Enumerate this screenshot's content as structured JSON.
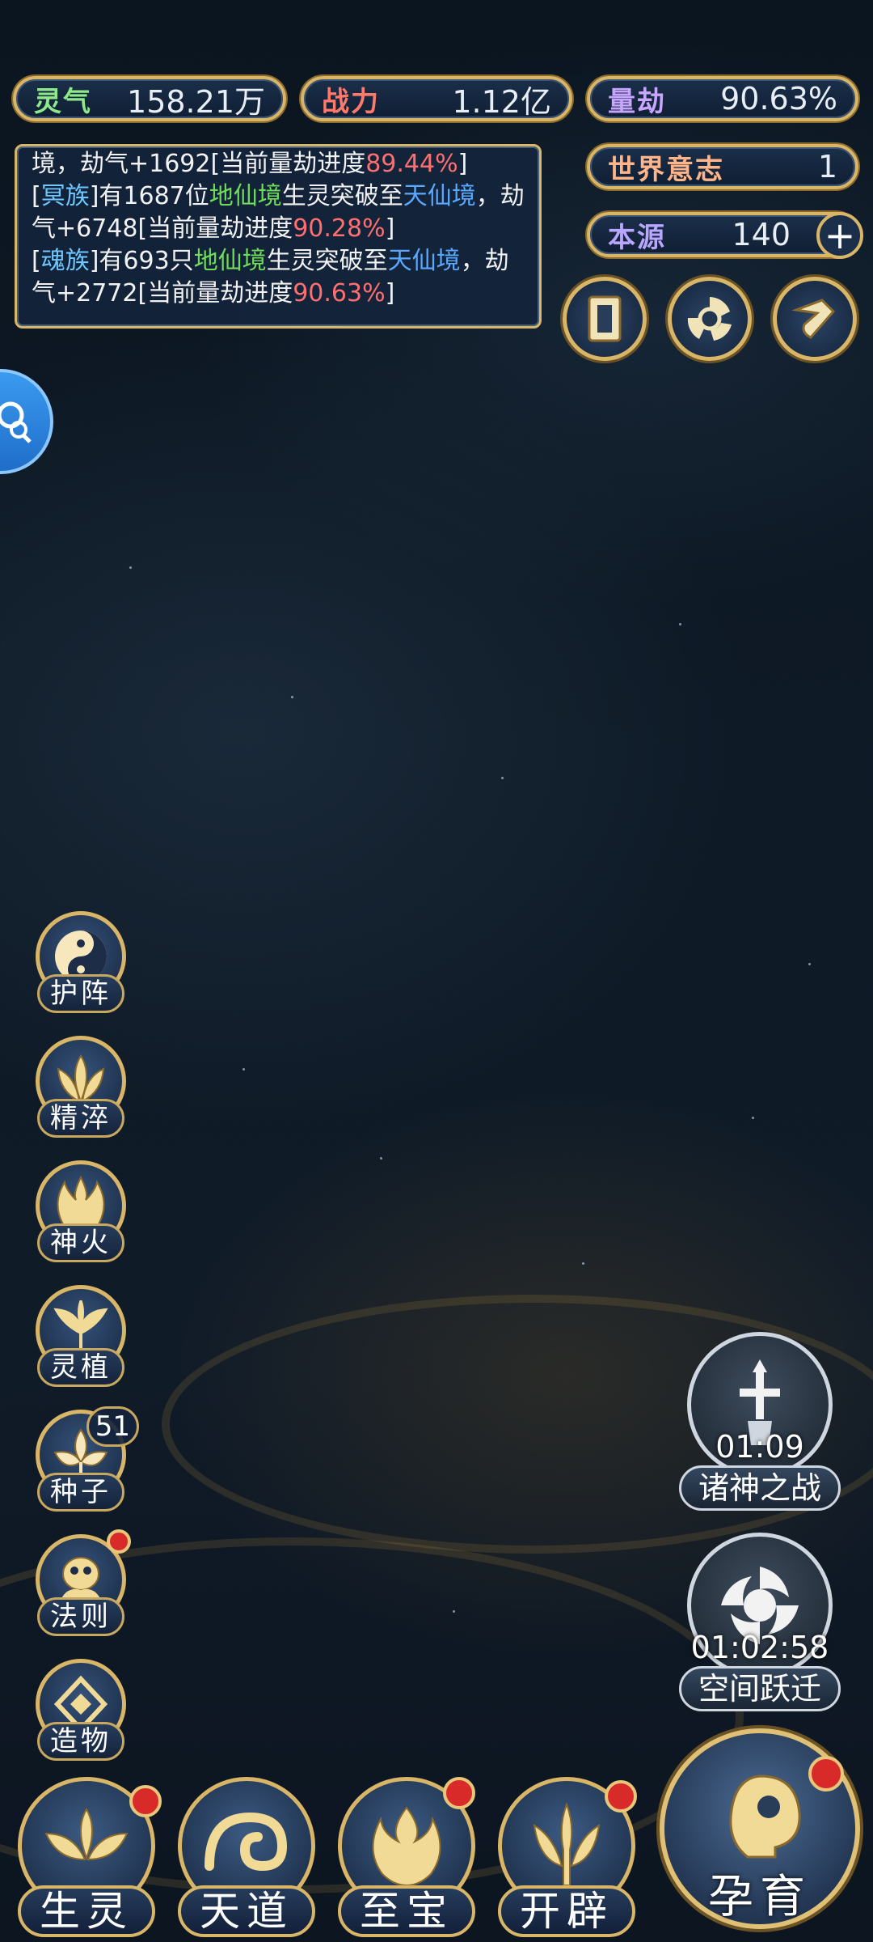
{
  "stats": {
    "lingqi": {
      "label": "灵气",
      "value": "158.21万"
    },
    "zhanli": {
      "label": "战力",
      "value": "1.12亿"
    },
    "liangjie": {
      "label": "量劫",
      "value": "90.63%"
    },
    "shijie": {
      "label": "世界意志",
      "value": "1"
    },
    "benyuan": {
      "label": "本源",
      "value": "140"
    }
  },
  "log": {
    "line0": {
      "prefix": "境，劫气+1692[当前量劫进度",
      "pct": "89.44%",
      "suffix": "]"
    },
    "line1": {
      "open": "[",
      "race": "冥族",
      "mid1": "]有1687位",
      "realm1": "地仙境",
      "mid2": "生灵突破至",
      "realm2": "天仙境",
      "mid3": "，劫气+6748[当前量劫进度",
      "pct": "90.28%",
      "suffix": "]"
    },
    "line2": {
      "open": "[",
      "race": "魂族",
      "mid1": "]有693只",
      "realm1": "地仙境",
      "mid2": "生灵突破至",
      "realm2": "天仙境",
      "mid3": "，劫气+2772[当前量劫进度",
      "pct": "90.63%",
      "suffix": "]"
    }
  },
  "top_icons": [
    "card-icon",
    "vortex-icon",
    "scroll-icon"
  ],
  "side_menu": [
    {
      "label": "护阵",
      "icon": "yin-yang-icon"
    },
    {
      "label": "精淬",
      "icon": "lotus-flame-icon"
    },
    {
      "label": "神火",
      "icon": "fire-icon"
    },
    {
      "label": "灵植",
      "icon": "plant-icon"
    },
    {
      "label": "种子",
      "icon": "seed-icon",
      "badge": "51"
    },
    {
      "label": "法则",
      "icon": "law-icon"
    },
    {
      "label": "造物",
      "icon": "creation-icon"
    }
  ],
  "events": [
    {
      "name": "诸神之战",
      "timer": "01:09"
    },
    {
      "name": "空间跃迁",
      "timer": "01:02:58"
    }
  ],
  "bottom_nav": [
    {
      "label": "生灵"
    },
    {
      "label": "天道"
    },
    {
      "label": "至宝"
    },
    {
      "label": "开辟"
    },
    {
      "label": "孕育"
    }
  ],
  "colors": {
    "gold": "#d9b667",
    "green": "#6fdc5a",
    "blue": "#5aa9ff",
    "red": "#ff6f6f"
  }
}
